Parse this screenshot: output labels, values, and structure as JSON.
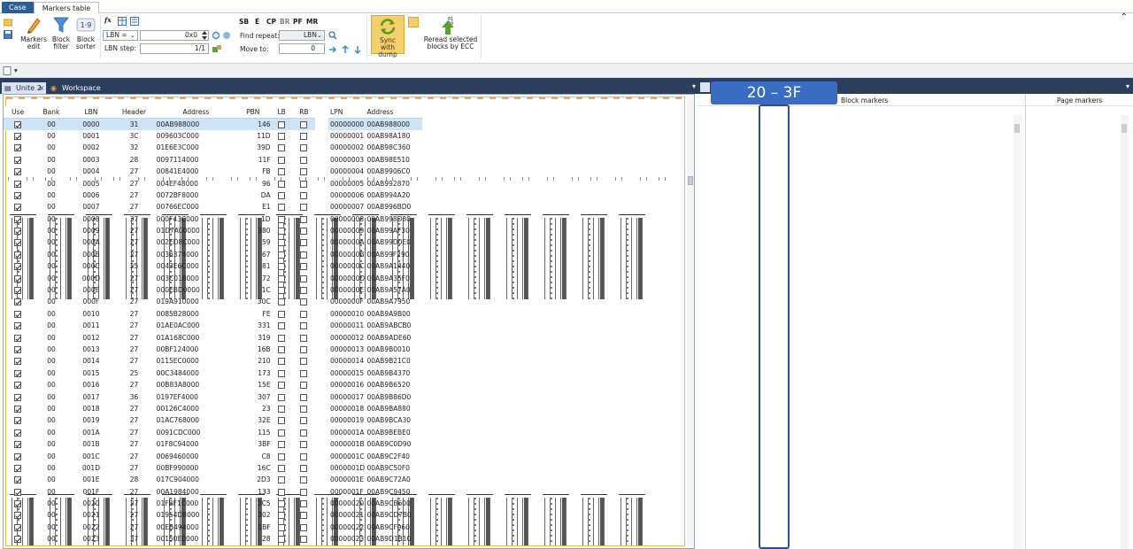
{
  "top_tabs": {
    "case": "Case",
    "markers_table": "Markers table"
  },
  "ribbon": {
    "markers_edit": [
      "Markers",
      "edit"
    ],
    "block_filter": [
      "Block",
      "filter"
    ],
    "block_sorter": [
      "Block",
      "sorter"
    ],
    "lbn_select": "LBN =",
    "lbn_value": "0x0",
    "lbn_step_label": "LBN step:",
    "lbn_step_value": "1/1",
    "flags": [
      "SB",
      "E",
      "CP",
      "BR",
      "PF",
      "MR"
    ],
    "find_repeat_label": "Find repeat:",
    "find_repeat_value": "LBN",
    "move_to_label": "Move to:",
    "move_to_value": "0",
    "sync_with_dump": [
      "Sync with",
      "dump"
    ],
    "reread": [
      "Reread selected",
      "blocks by ECC"
    ]
  },
  "doc_tabs": {
    "unite": "Unite 2",
    "workspace": "Workspace"
  },
  "callout": "20 – 3F",
  "block_markers": {
    "title": "Block markers",
    "columns": [
      "Use",
      "Bank",
      "LBN",
      "Header",
      "Address",
      "PBN",
      "LB",
      "RB"
    ],
    "rows": [
      [
        "00",
        "0000",
        "31",
        "00AB988000",
        "146"
      ],
      [
        "00",
        "0001",
        "3C",
        "009603C000",
        "11D"
      ],
      [
        "00",
        "0002",
        "32",
        "01E6E3C000",
        "39D"
      ],
      [
        "00",
        "0003",
        "28",
        "0097114000",
        "11F"
      ],
      [
        "00",
        "0004",
        "27",
        "00841E4000",
        "FB"
      ],
      [
        "00",
        "0005",
        "27",
        "004EF48000",
        "96"
      ],
      [
        "00",
        "0006",
        "27",
        "0072BF8000",
        "DA"
      ],
      [
        "00",
        "0007",
        "27",
        "00766EC000",
        "E1"
      ],
      [
        "00",
        "0008",
        "37",
        "000F43C000",
        "1D"
      ],
      [
        "00",
        "0009",
        "27",
        "01D7A00000",
        "380"
      ],
      [
        "00",
        "000A",
        "27",
        "002ED8C000",
        "59"
      ],
      [
        "00",
        "000B",
        "27",
        "0036374000",
        "67"
      ],
      [
        "00",
        "000C",
        "25",
        "0043E6C000",
        "81"
      ],
      [
        "00",
        "000D",
        "27",
        "003C018000",
        "72"
      ],
      [
        "00",
        "000E",
        "27",
        "000EBD0000",
        "1C"
      ],
      [
        "00",
        "000F",
        "27",
        "019A910000",
        "30C"
      ],
      [
        "00",
        "0010",
        "27",
        "0085B28000",
        "FE"
      ],
      [
        "00",
        "0011",
        "27",
        "01AE0AC000",
        "331"
      ],
      [
        "00",
        "0012",
        "27",
        "01A168C000",
        "319"
      ],
      [
        "00",
        "0013",
        "27",
        "00BF124000",
        "16B"
      ],
      [
        "00",
        "0014",
        "27",
        "0115EC0000",
        "210"
      ],
      [
        "00",
        "0015",
        "25",
        "00C3484000",
        "173"
      ],
      [
        "00",
        "0016",
        "27",
        "00B83A8000",
        "15E"
      ],
      [
        "00",
        "0017",
        "36",
        "0197EF4000",
        "307"
      ],
      [
        "00",
        "0018",
        "27",
        "00126C4000",
        "23"
      ],
      [
        "00",
        "0019",
        "27",
        "01AC768000",
        "32E"
      ],
      [
        "00",
        "001A",
        "27",
        "0091CDC000",
        "115"
      ],
      [
        "00",
        "001B",
        "27",
        "01F8C94000",
        "3BF"
      ],
      [
        "00",
        "001C",
        "27",
        "0069460000",
        "C8"
      ],
      [
        "00",
        "001D",
        "27",
        "00BF990000",
        "16C"
      ],
      [
        "00",
        "001E",
        "28",
        "017C904000",
        "2D3"
      ],
      [
        "00",
        "001F",
        "27",
        "00A1984000",
        "133"
      ],
      [
        "00",
        "0020",
        "27",
        "01FBF1C000",
        "3C5"
      ],
      [
        "00",
        "0021",
        "27",
        "01954D8000",
        "302"
      ],
      [
        "00",
        "0022",
        "27",
        "00EB494000",
        "1BF"
      ],
      [
        "00",
        "0023",
        "37",
        "00150E0000",
        "28"
      ]
    ]
  },
  "page_markers": {
    "title": "Page markers",
    "columns": [
      "LPN",
      "Address"
    ],
    "rows": [
      [
        "00000000",
        "00AB988000"
      ],
      [
        "00000001",
        "00AB98A180"
      ],
      [
        "00000002",
        "00AB98C360"
      ],
      [
        "00000003",
        "00AB98E510"
      ],
      [
        "00000004",
        "00AB9906C0"
      ],
      [
        "00000005",
        "00AB992870"
      ],
      [
        "00000006",
        "00AB994A20"
      ],
      [
        "00000007",
        "00AB996BD0"
      ],
      [
        "00000008",
        "00AB998D80"
      ],
      [
        "00000009",
        "00AB99AF30"
      ],
      [
        "0000000A",
        "00AB99D0E0"
      ],
      [
        "0000000B",
        "00AB99F290"
      ],
      [
        "0000000C",
        "00AB9A1440"
      ],
      [
        "0000000D",
        "00AB9A35F0"
      ],
      [
        "0000000E",
        "00AB9A57A0"
      ],
      [
        "0000000F",
        "00AB9A7950"
      ],
      [
        "00000010",
        "00AB9A9B00"
      ],
      [
        "00000011",
        "00AB9ABCB0"
      ],
      [
        "00000012",
        "00AB9ADE60"
      ],
      [
        "00000013",
        "00AB9B0010"
      ],
      [
        "00000014",
        "00AB9B21C0"
      ],
      [
        "00000015",
        "00AB9B4370"
      ],
      [
        "00000016",
        "00AB9B6520"
      ],
      [
        "00000017",
        "00AB9B86D0"
      ],
      [
        "00000018",
        "00AB9BA880"
      ],
      [
        "00000019",
        "00AB9BCA30"
      ],
      [
        "0000001A",
        "00AB9BEBE0"
      ],
      [
        "0000001B",
        "00AB9C0D90"
      ],
      [
        "0000001C",
        "00AB9C2F40"
      ],
      [
        "0000001D",
        "00AB9C50F0"
      ],
      [
        "0000001E",
        "00AB9C72A0"
      ],
      [
        "0000001F",
        "00AB9C9450"
      ],
      [
        "00000020",
        "00AB9CB600"
      ],
      [
        "00000021",
        "00AB9CD7B0"
      ],
      [
        "00000022",
        "00AB9CF960"
      ],
      [
        "00000023",
        "00AB9D1B10"
      ]
    ]
  },
  "colors": {
    "accent": "#3b6cc4",
    "header_bar": "#2c3e5c",
    "sync_button": "#f5cf6a",
    "dump_marks": "#555555"
  }
}
